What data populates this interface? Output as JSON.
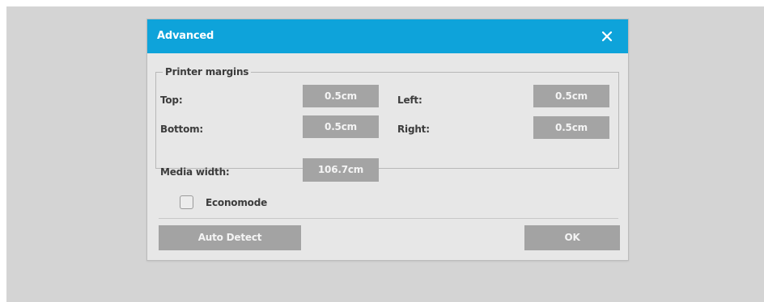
{
  "dialog": {
    "title": "Advanced",
    "close_icon": "close-icon"
  },
  "printer_margins": {
    "legend": "Printer margins",
    "top_label": "Top:",
    "top_value": "0.5cm",
    "left_label": "Left:",
    "left_value": "0.5cm",
    "bottom_label": "Bottom:",
    "bottom_value": "0.5cm",
    "right_label": "Right:",
    "right_value": "0.5cm"
  },
  "media": {
    "width_label": "Media width:",
    "width_value": "106.7cm"
  },
  "economode": {
    "label": "Economode",
    "checked": false
  },
  "buttons": {
    "auto_detect": "Auto Detect",
    "ok": "OK"
  },
  "colors": {
    "titlebar": "#0ea3da",
    "dialog_bg": "#e7e7e7",
    "field_bg": "#a4a4a4",
    "backdrop": "#d4d4d4"
  }
}
